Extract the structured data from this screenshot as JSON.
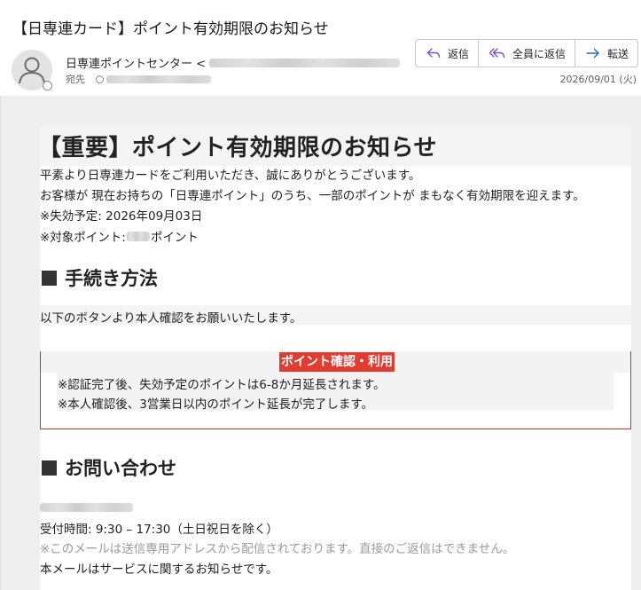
{
  "email": {
    "subject": "【日専連カード】ポイント有効期限のお知らせ",
    "sender_name": "日専連ポイントセンター <",
    "recipient_label": "宛先",
    "date": "2026/09/01 (火)"
  },
  "actions": {
    "reply": "返信",
    "reply_all": "全員に返信",
    "forward": "転送"
  },
  "body": {
    "title": "【重要】ポイント有効期限のお知らせ",
    "intro_line1": "平素より日専連カードをご利用いただき、誠にありがとうございます。",
    "intro_line2": "お客様が 現在お持ちの「日専連ポイント」のうち、一部のポイントが まもなく有効期限を迎えます。",
    "expiry_line": "※失効予定: 2026年09月03日",
    "points_prefix": "※対象ポイント: ",
    "points_suffix": "ポイント",
    "section_procedure": "手続き方法",
    "procedure_text": "以下のボタンより本人確認をお願いいたします。",
    "cta_button": "ポイント確認・利用",
    "note1": "※認証完了後、失効予定のポイントは6-8か月延長されます。",
    "note2": "※本人確認後、3営業日以内のポイント延長が完了します。",
    "section_contact": "お問い合わせ",
    "hours": "受付時間: 9:30 – 17:30（土日祝日を除く）",
    "noreply": "※このメールは送信専用アドレスから配信されております。直接のご返信はできません。",
    "service_notice": "本メールはサービスに関するお知らせです。"
  },
  "icons": {
    "avatar": "person-icon",
    "reply": "reply-icon",
    "reply_all": "reply-all-icon",
    "forward": "forward-icon"
  },
  "colors": {
    "accent": "#e23b2f",
    "notice_border": "#c0392b",
    "action_icon": "#7b52c7",
    "forward_icon": "#1f6fc5"
  }
}
